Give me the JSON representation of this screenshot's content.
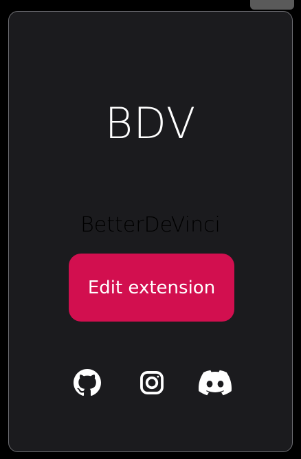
{
  "card": {
    "title": "BDV",
    "subtitle": "BetterDeVinci",
    "edit_button_label": "Edit extension"
  },
  "social_links": [
    {
      "name": "github",
      "icon": "github-icon"
    },
    {
      "name": "instagram",
      "icon": "instagram-icon"
    },
    {
      "name": "discord",
      "icon": "discord-icon"
    }
  ],
  "colors": {
    "background": "#000000",
    "card": "#1b1b1e",
    "card_border": "#6f6f74",
    "accent": "#d20f4f",
    "text": "#ffffff"
  }
}
